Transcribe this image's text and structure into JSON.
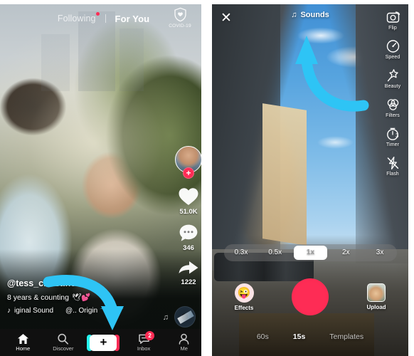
{
  "feed": {
    "tabs": [
      {
        "label": "Following",
        "active": false,
        "has_dot": true
      },
      {
        "label": "For You",
        "active": true,
        "has_dot": false
      }
    ],
    "covid_label": "COVID-19",
    "covid_icon": "shield-heart-icon",
    "actions": {
      "avatar_icon": "profile-avatar",
      "follow_label": "+",
      "like_icon": "heart-icon",
      "like_count": "51.0K",
      "comment_icon": "comment-icon",
      "comment_count": "346",
      "share_icon": "share-arrow-icon",
      "share_count": "1222"
    },
    "caption": {
      "username": "@tess_christine",
      "text": "8 years & counting",
      "emoji": "🕊💕",
      "music_icon": "music-note-icon",
      "music_text": "iginal Sound",
      "music_author": "@.. Origin"
    },
    "disc_icon": "vinyl-record-icon",
    "nav": [
      {
        "label": "Home",
        "icon": "home-icon",
        "active": true,
        "badge": ""
      },
      {
        "label": "Discover",
        "icon": "search-icon",
        "active": false,
        "badge": ""
      },
      {
        "label": "",
        "icon": "plus-icon",
        "active": false,
        "badge": ""
      },
      {
        "label": "Inbox",
        "icon": "inbox-icon",
        "active": false,
        "badge": "2"
      },
      {
        "label": "Me",
        "icon": "person-icon",
        "active": false,
        "badge": ""
      }
    ]
  },
  "camera": {
    "close_icon": "close-x-icon",
    "sounds_label": "Sounds",
    "sounds_icon": "music-note-icon",
    "tools": [
      {
        "label": "Flip",
        "icon": "flip-camera-icon"
      },
      {
        "label": "Speed",
        "icon": "speedometer-icon"
      },
      {
        "label": "Beauty",
        "icon": "beauty-wand-icon"
      },
      {
        "label": "Filters",
        "icon": "filters-circles-icon"
      },
      {
        "label": "Timer",
        "icon": "timer-icon"
      },
      {
        "label": "Flash",
        "icon": "flash-off-icon"
      }
    ],
    "speeds": [
      {
        "label": "0.3x",
        "active": false
      },
      {
        "label": "0.5x",
        "active": false
      },
      {
        "label": "1x",
        "active": true
      },
      {
        "label": "2x",
        "active": false
      },
      {
        "label": "3x",
        "active": false
      }
    ],
    "effects_label": "Effects",
    "effects_icon": "smiley-face-icon",
    "record_icon": "record-button",
    "upload_label": "Upload",
    "upload_icon": "gallery-thumbnail",
    "modes": [
      {
        "label": "60s",
        "active": false
      },
      {
        "label": "15s",
        "active": true
      },
      {
        "label": "Templates",
        "active": false
      }
    ]
  },
  "annotations": {
    "arrow_color": "#2ec4f5",
    "left_arrow": "curved-arrow-down-to-create-button",
    "right_arrow": "curved-arrow-up-to-sounds-button"
  }
}
